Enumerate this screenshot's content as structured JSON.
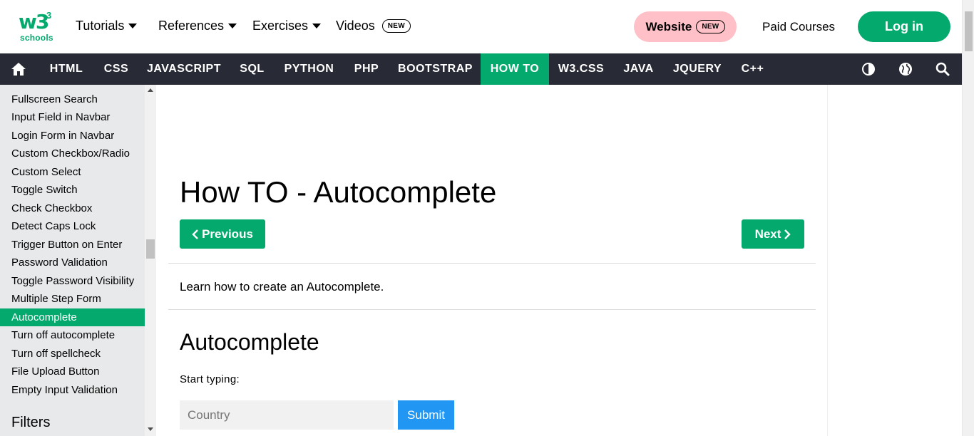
{
  "logo": {
    "main": "w3",
    "superscript": "3",
    "sub": "schools"
  },
  "top_nav": {
    "tutorials": "Tutorials",
    "references": "References",
    "exercises": "Exercises",
    "videos": "Videos",
    "videos_badge": "NEW",
    "website": "Website",
    "website_badge": "NEW",
    "paid_courses": "Paid Courses",
    "login": "Log in"
  },
  "dark_nav": {
    "items": [
      "HTML",
      "CSS",
      "JAVASCRIPT",
      "SQL",
      "PYTHON",
      "PHP",
      "BOOTSTRAP",
      "HOW TO",
      "W3.CSS",
      "JAVA",
      "JQUERY",
      "C++"
    ],
    "active": "HOW TO",
    "icons": [
      "home-icon",
      "contrast-icon",
      "globe-icon",
      "search-icon"
    ]
  },
  "sidebar": {
    "items": [
      "Fullscreen Search",
      "Input Field in Navbar",
      "Login Form in Navbar",
      "Custom Checkbox/Radio",
      "Custom Select",
      "Toggle Switch",
      "Check Checkbox",
      "Detect Caps Lock",
      "Trigger Button on Enter",
      "Password Validation",
      "Toggle Password Visibility",
      "Multiple Step Form",
      "Autocomplete",
      "Turn off autocomplete",
      "Turn off spellcheck",
      "File Upload Button",
      "Empty Input Validation"
    ],
    "active": "Autocomplete",
    "heading": "Filters"
  },
  "main": {
    "title": "How TO - Autocomplete",
    "previous": "Previous",
    "next": "Next",
    "intro": "Learn how to create an Autocomplete.",
    "subtitle": "Autocomplete",
    "start_label": "Start typing:",
    "input_placeholder": "Country",
    "submit": "Submit"
  },
  "colors": {
    "brand_green": "#04AA6D",
    "dark_nav": "#282A35",
    "sidebar_bg": "#E7E9EB",
    "website_pink": "#ffc0c7",
    "submit_blue": "#2196F3"
  }
}
